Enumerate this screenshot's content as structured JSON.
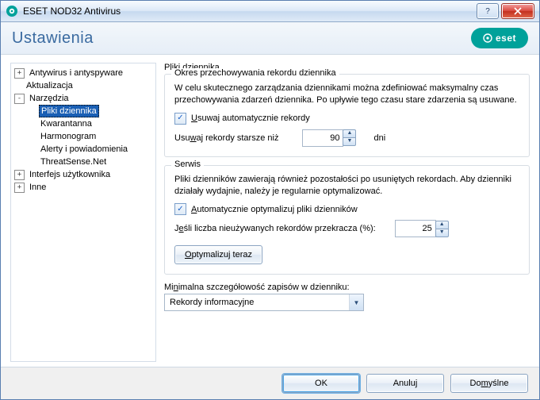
{
  "window": {
    "title": "ESET NOD32 Antivirus"
  },
  "banner": {
    "heading": "Ustawienia",
    "logo_text": "eset"
  },
  "tree": {
    "items": [
      {
        "label": "Antywirus i antyspyware",
        "level": 0,
        "expander": "+",
        "selected": false
      },
      {
        "label": "Aktualizacja",
        "level": 0,
        "expander": "",
        "selected": false
      },
      {
        "label": "Narzędzia",
        "level": 0,
        "expander": "-",
        "selected": false
      },
      {
        "label": "Pliki dziennika",
        "level": 1,
        "expander": "",
        "selected": true
      },
      {
        "label": "Kwarantanna",
        "level": 1,
        "expander": "",
        "selected": false
      },
      {
        "label": "Harmonogram",
        "level": 1,
        "expander": "",
        "selected": false
      },
      {
        "label": "Alerty i powiadomienia",
        "level": 1,
        "expander": "",
        "selected": false
      },
      {
        "label": "ThreatSense.Net",
        "level": 1,
        "expander": "",
        "selected": false
      },
      {
        "label": "Interfejs użytkownika",
        "level": 0,
        "expander": "+",
        "selected": false
      },
      {
        "label": "Inne",
        "level": 0,
        "expander": "+",
        "selected": false
      }
    ]
  },
  "main": {
    "page_title": "Pliki dziennika",
    "group1": {
      "legend": "Okres przechowywania rekordu dziennika",
      "description": "W celu skutecznego zarządzania dziennikami można zdefiniować maksymalny czas przechowywania zdarzeń dziennika. Po upływie tego czasu stare zdarzenia są usuwane.",
      "checkbox_pre": "U",
      "checkbox_post": "suwaj automatycznie rekordy",
      "days_pre": "Usu",
      "days_key": "w",
      "days_post": "aj rekordy starsze niż",
      "days_value": "90",
      "days_unit": "dni"
    },
    "group2": {
      "legend": "Serwis",
      "description": "Pliki dzienników zawierają również pozostałości po usuniętych rekordach. Aby dzienniki działały wydajnie, należy je regularnie optymalizować.",
      "checkbox_pre": "A",
      "checkbox_post": "utomatycznie optymalizuj pliki dzienników",
      "pct_pre": "J",
      "pct_key": "e",
      "pct_post": "śli liczba nieużywanych rekordów przekracza (%):",
      "pct_value": "25",
      "optimize_pre": "O",
      "optimize_post": "ptymalizuj teraz"
    },
    "detail": {
      "label_pre": "Mi",
      "label_key": "n",
      "label_post": "imalna szczegółowość zapisów w dzienniku:",
      "selected": "Rekordy informacyjne"
    }
  },
  "footer": {
    "ok": "OK",
    "cancel_pre": "Anulu",
    "cancel_key": "j",
    "default_pre": "Do",
    "default_key": "m",
    "default_post": "yślne"
  }
}
